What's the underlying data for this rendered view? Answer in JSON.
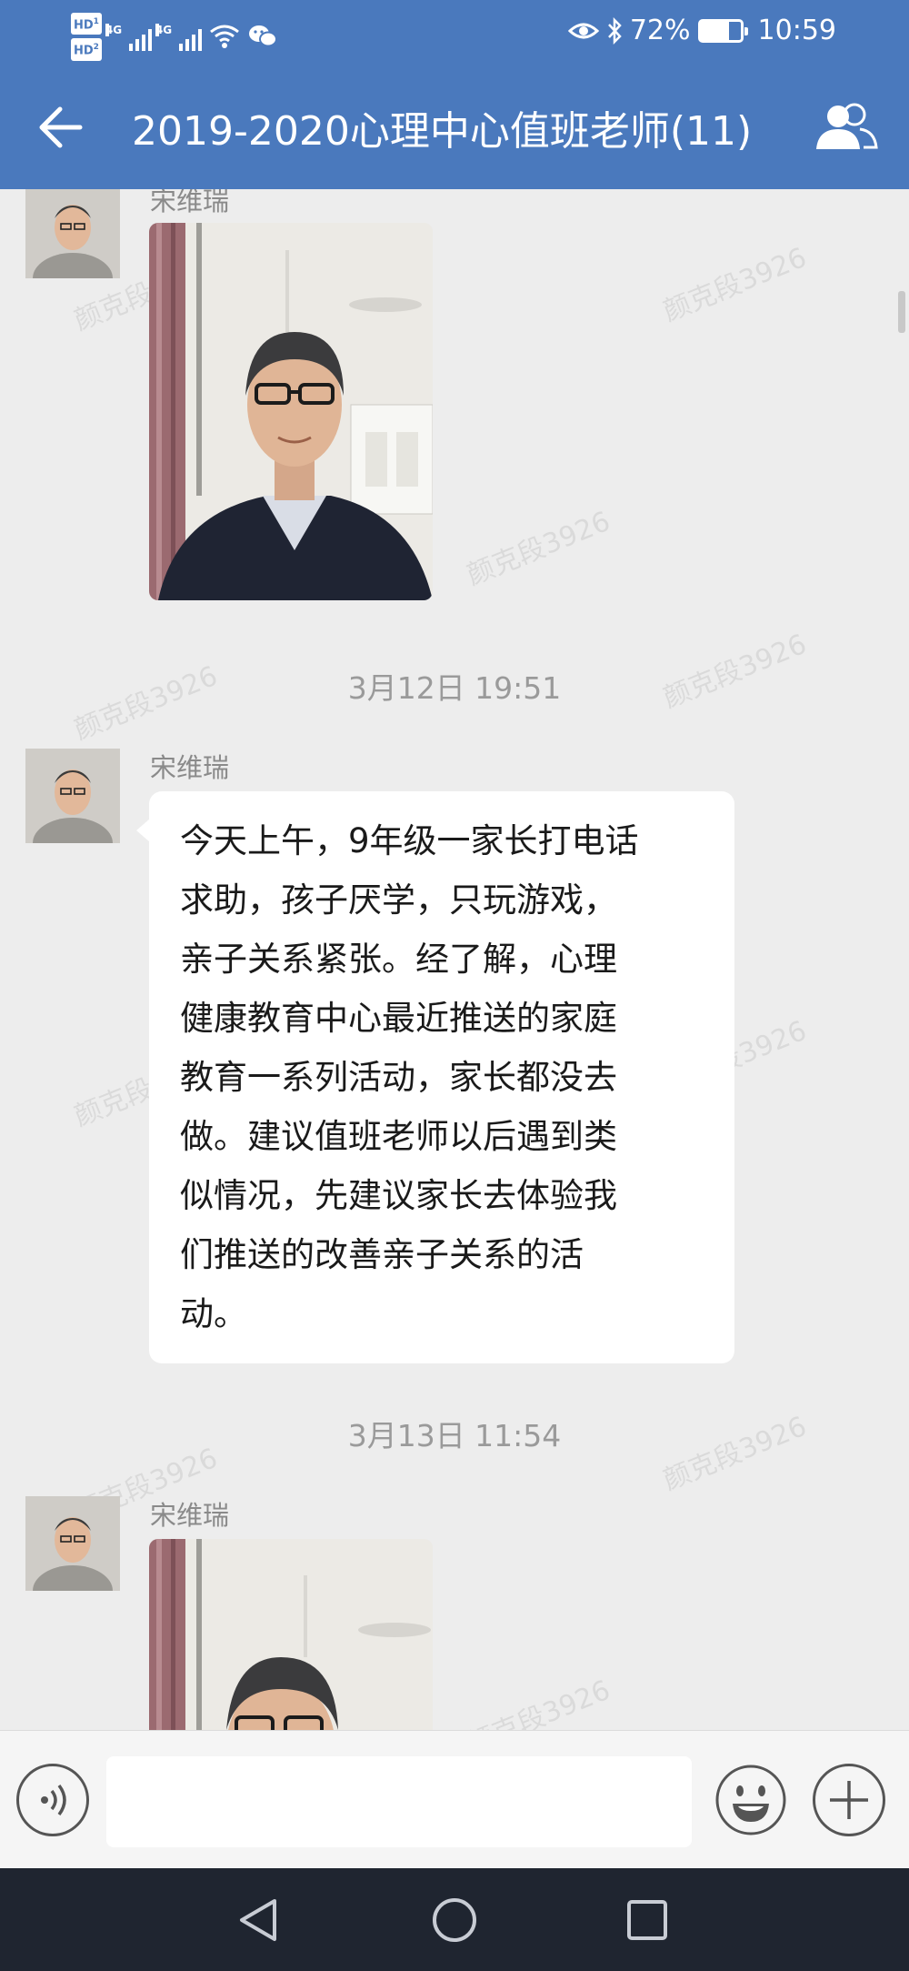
{
  "status_bar": {
    "hd1": "HD",
    "hd1_sub": "1",
    "hd2": "HD",
    "hd2_sub": "2",
    "net1": "4G",
    "net2": "4G",
    "battery_text": "72%",
    "battery_level": 0.72,
    "time": "10:59",
    "icons": [
      "signal-icon",
      "wifi-icon",
      "wechat-icon",
      "eye-icon",
      "bluetooth-icon",
      "battery-icon"
    ]
  },
  "header": {
    "title": "2019-2020心理中心值班老师(11)",
    "back_icon": "back-arrow-icon",
    "members_icon": "group-members-icon"
  },
  "watermark": "颜克段3926",
  "messages": [
    {
      "type": "image",
      "sender": "宋维瑞"
    },
    {
      "type": "timestamp",
      "text": "3月12日  19:51"
    },
    {
      "type": "text",
      "sender": "宋维瑞",
      "lines": [
        "今天上午，9年级一家长打电话",
        "求助，孩子厌学，只玩游戏，",
        "亲子关系紧张。经了解，心理",
        "健康教育中心最近推送的家庭",
        "教育一系列活动，家长都没去",
        "做。建议值班老师以后遇到类",
        "似情况，先建议家长去体验我",
        "们推送的改善亲子关系的活",
        "动。"
      ]
    },
    {
      "type": "timestamp",
      "text": "3月13日  11:54"
    },
    {
      "type": "image",
      "sender": "宋维瑞"
    }
  ],
  "input_bar": {
    "message_value": "",
    "voice_icon": "voice-icon",
    "emoji_icon": "emoji-icon",
    "plus_icon": "plus-icon"
  },
  "nav_bar": {
    "icons": [
      "nav-back-icon",
      "nav-home-icon",
      "nav-recent-icon"
    ]
  },
  "colors": {
    "header": "#4a79bd",
    "chat_background": "#ededed",
    "bubble": "#ffffff",
    "nav_bar": "#1f2530"
  }
}
